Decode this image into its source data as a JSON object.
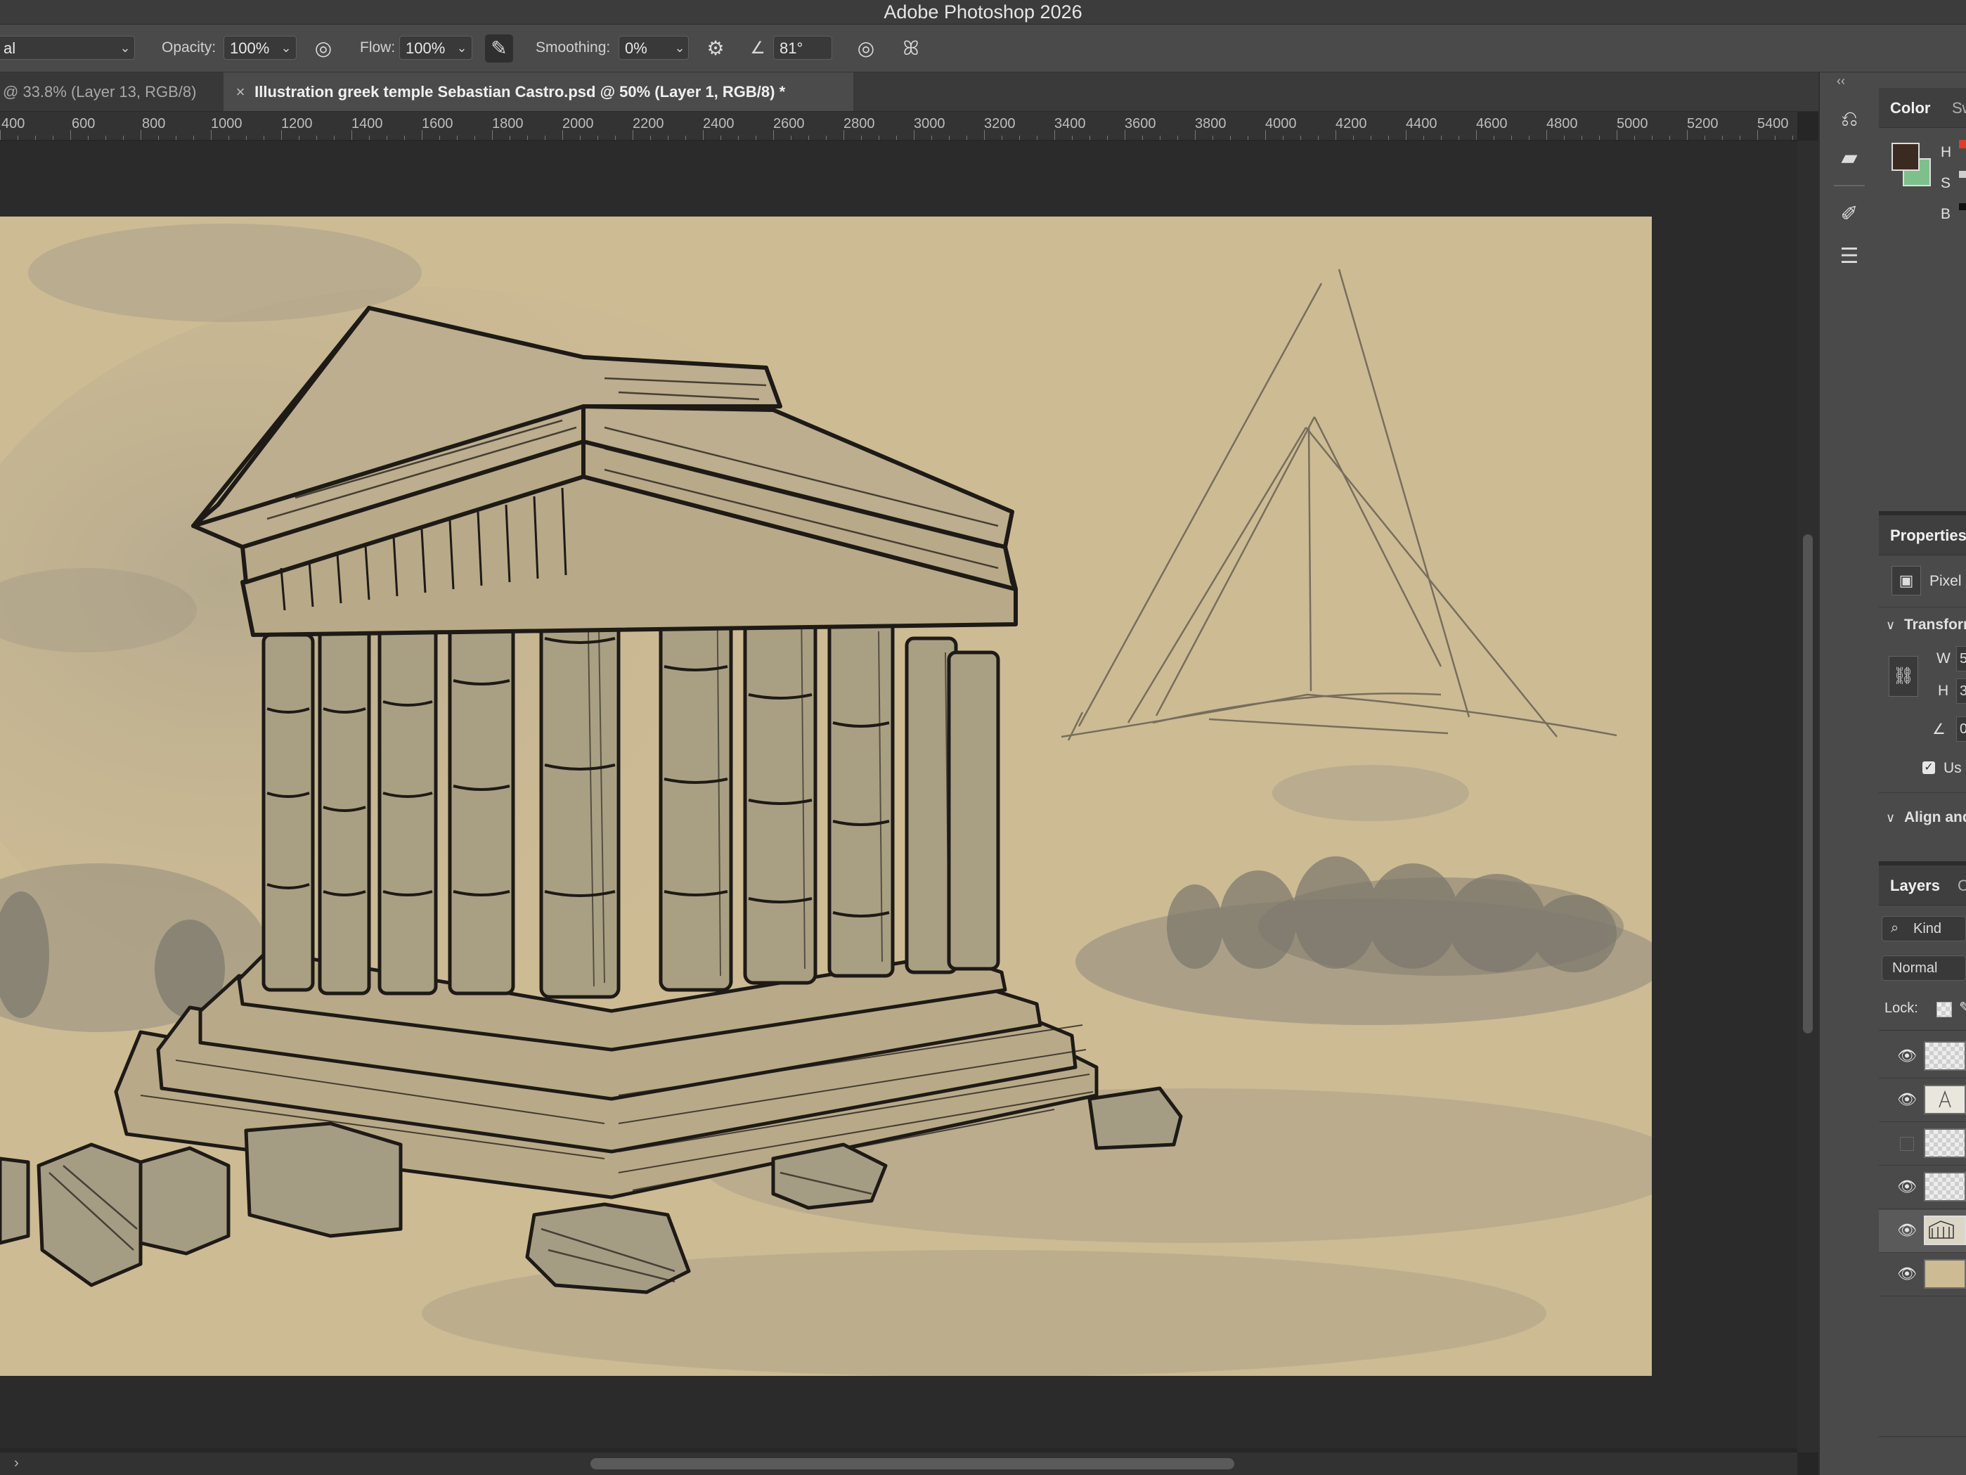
{
  "app": {
    "title": "Adobe Photoshop 2026"
  },
  "options": {
    "mode_value": "al",
    "opacity_label": "Opacity:",
    "opacity_value": "100%",
    "flow_label": "Flow:",
    "flow_value": "100%",
    "smoothing_label": "Smoothing:",
    "smoothing_value": "0%",
    "angle_value": "81°"
  },
  "tabs": [
    {
      "label": "@ 33.8% (Layer 13, RGB/8)"
    },
    {
      "label": "Illustration greek temple Sebastian Castro.psd @ 50% (Layer 1, RGB/8) *"
    }
  ],
  "ruler": {
    "ticks": [
      "400",
      "600",
      "800",
      "1000",
      "1200",
      "1400",
      "1600",
      "1800",
      "2000",
      "2200",
      "2400",
      "2600",
      "2800",
      "3000",
      "3200",
      "3400",
      "3600",
      "3800",
      "4000",
      "4200",
      "4400",
      "4600",
      "4800",
      "5000",
      "5200",
      "5400"
    ]
  },
  "panels": {
    "color": {
      "title": "Color",
      "tab2": "Sw",
      "labels": [
        "H",
        "S",
        "B"
      ],
      "fg_color": "#3b2a20",
      "bg_color": "#7ec08b"
    },
    "properties": {
      "title": "Properties",
      "type_label": "Pixel",
      "transform_title": "Transform",
      "w_label": "W",
      "w_value": "5",
      "h_label": "H",
      "h_value": "3",
      "angle_value": "0",
      "checkbox_label": "Us",
      "align_title": "Align and"
    },
    "layers": {
      "title": "Layers",
      "tab2": "C",
      "filter_label": "Kind",
      "blend_mode": "Normal",
      "lock_label": "Lock:",
      "rows": [
        {
          "visible": true,
          "thumb": "transparent"
        },
        {
          "visible": true,
          "thumb": "sketch"
        },
        {
          "visible": false,
          "thumb": "transparent"
        },
        {
          "visible": true,
          "thumb": "transparent"
        },
        {
          "visible": true,
          "thumb": "temple"
        },
        {
          "visible": true,
          "thumb": "paper"
        }
      ]
    }
  },
  "colors": {
    "canvas_paper": "#cdbb94",
    "ink": "#1e1a16"
  }
}
